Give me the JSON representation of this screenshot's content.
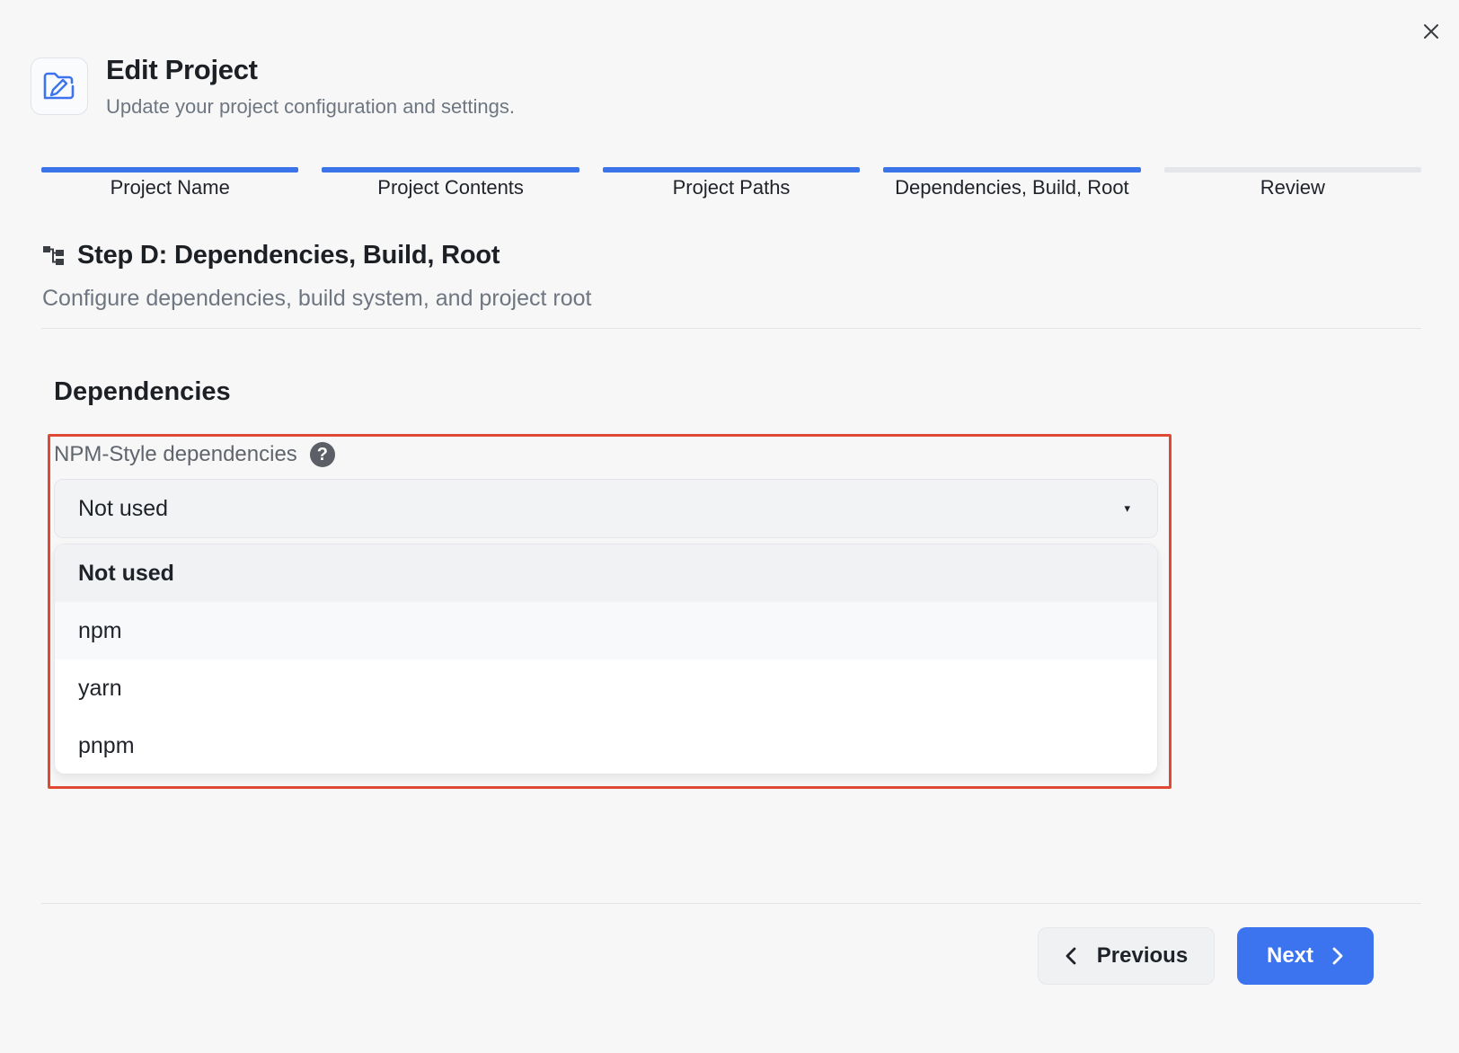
{
  "dialog": {
    "title": "Edit Project",
    "subtitle": "Update your project configuration and settings.",
    "icon": "folder-edit-icon",
    "close_icon": "close-icon"
  },
  "steps": [
    {
      "label": "Project Name",
      "completed": true
    },
    {
      "label": "Project Contents",
      "completed": true
    },
    {
      "label": "Project Paths",
      "completed": true
    },
    {
      "label": "Dependencies, Build, Root",
      "completed": true
    },
    {
      "label": "Review",
      "completed": false
    }
  ],
  "step_section": {
    "icon": "hierarchy-icon",
    "title": "Step D: Dependencies, Build, Root",
    "description": "Configure dependencies, build system, and project root"
  },
  "dependencies": {
    "section_title": "Dependencies",
    "field_label": "NPM-Style dependencies",
    "help_icon": "help-icon",
    "help_glyph": "?",
    "selected_value": "Not used",
    "caret": "▾",
    "options": [
      "Not used",
      "npm",
      "yarn",
      "pnpm"
    ]
  },
  "footer": {
    "previous_label": "Previous",
    "next_label": "Next"
  },
  "colors": {
    "accent": "#3b74ee",
    "highlight_border": "#e04a35",
    "inactive_step": "#e4e6ea",
    "background": "#f7f7f7"
  }
}
